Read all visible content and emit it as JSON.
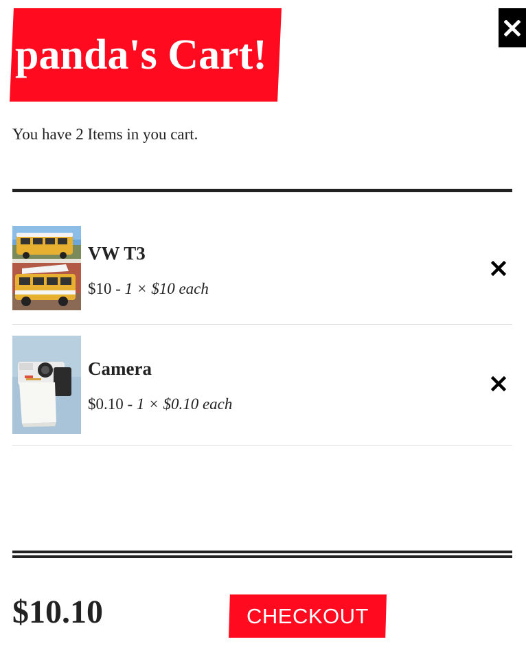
{
  "header": {
    "title": "panda's Cart!",
    "close_icon": "close-icon"
  },
  "summary": {
    "count_text": "You have 2 Items in you cart."
  },
  "items": [
    {
      "name": "VW T3",
      "price": "$10",
      "separator": " - ",
      "detail": "1 × $10 each",
      "image": "vw-van-photo",
      "remove_icon": "close-icon"
    },
    {
      "name": "Camera",
      "price": "$0.10",
      "separator": " - ",
      "detail": "1 × $0.10 each",
      "image": "polaroid-camera-photo",
      "remove_icon": "close-icon"
    }
  ],
  "footer": {
    "total": "$10.10",
    "checkout_label": "CHECKOUT"
  },
  "colors": {
    "accent": "#ff0a1f",
    "text": "#222222",
    "close_bg": "#000000"
  }
}
